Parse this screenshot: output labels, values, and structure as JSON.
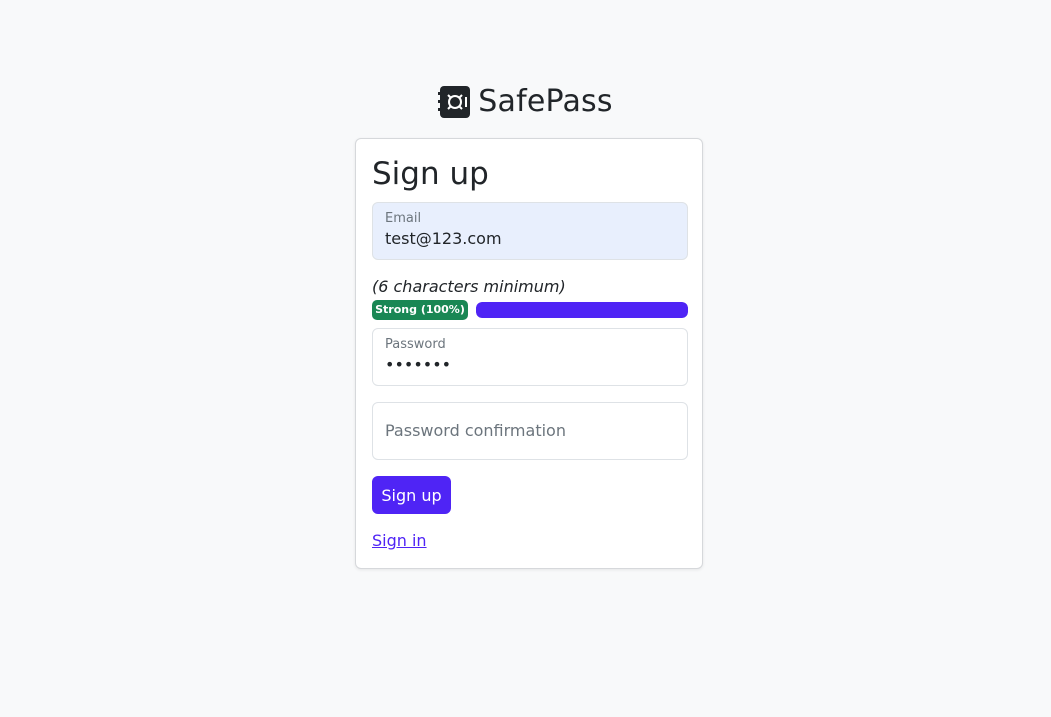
{
  "brand": {
    "name": "SafePass",
    "icon": "vault-icon"
  },
  "form": {
    "title": "Sign up",
    "email": {
      "label": "Email",
      "value": "test@123.com"
    },
    "password_hint": "(6 characters minimum)",
    "strength": {
      "label": "Strong (100%)",
      "level": 1.0
    },
    "password": {
      "label": "Password",
      "value": "•••••••"
    },
    "password_confirmation": {
      "placeholder": "Password confirmation"
    },
    "submit_label": "Sign up",
    "signin_link": "Sign in"
  },
  "colors": {
    "accent": "#4f24f5",
    "success": "#198754",
    "background": "#f8f9fa",
    "autofill": "#e8effd"
  }
}
